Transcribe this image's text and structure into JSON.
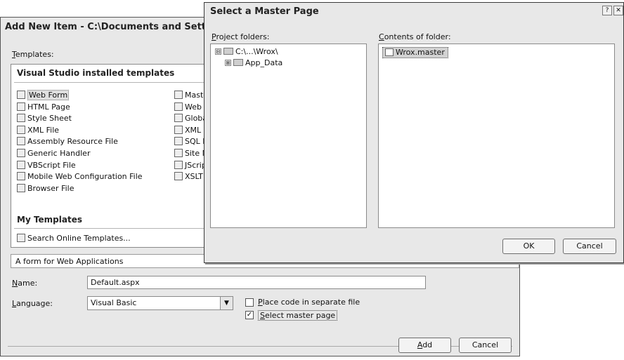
{
  "add_item_dialog": {
    "title": "Add New Item - C:\\Documents and Settin",
    "templates_label": "Templates:",
    "installed_header": "Visual Studio installed templates",
    "templates_left": [
      {
        "label": "Web Form",
        "icon": "web-form-icon",
        "selected": true
      },
      {
        "label": "HTML Page",
        "icon": "html-page-icon"
      },
      {
        "label": "Style Sheet",
        "icon": "style-sheet-icon"
      },
      {
        "label": "XML File",
        "icon": "xml-file-icon"
      },
      {
        "label": "Assembly Resource File",
        "icon": "resource-file-icon"
      },
      {
        "label": "Generic Handler",
        "icon": "generic-handler-icon"
      },
      {
        "label": "VBScript File",
        "icon": "vbscript-file-icon"
      },
      {
        "label": "Mobile Web Configuration File",
        "icon": "mobile-config-icon"
      },
      {
        "label": "Browser File",
        "icon": "browser-file-icon"
      }
    ],
    "templates_right": [
      {
        "label": "Maste",
        "icon": "master-page-icon"
      },
      {
        "label": "Web",
        "icon": "web-service-icon"
      },
      {
        "label": "Globa",
        "icon": "global-app-icon"
      },
      {
        "label": "XML S",
        "icon": "xml-schema-icon"
      },
      {
        "label": "SQL D",
        "icon": "sql-database-icon"
      },
      {
        "label": "Site M",
        "icon": "site-map-icon"
      },
      {
        "label": "JScrip",
        "icon": "jscript-file-icon"
      },
      {
        "label": "XSLT",
        "icon": "xslt-file-icon"
      }
    ],
    "my_templates_header": "My Templates",
    "search_online": "Search Online Templates...",
    "description": "A form for Web Applications",
    "name_label": "Name:",
    "name_value": "Default.aspx",
    "language_label": "Language:",
    "language_value": "Visual Basic",
    "place_code_label": "Place code in separate file",
    "place_code_checked": false,
    "select_master_label": "Select master page",
    "select_master_checked": true,
    "add_button": "Add",
    "cancel_button": "Cancel"
  },
  "master_page_dialog": {
    "title": "Select a Master Page",
    "project_folders_label": "Project folders:",
    "contents_label": "Contents of folder:",
    "tree": [
      {
        "label": "C:\\...\\Wrox\\",
        "expander": "⊟",
        "icon": "web-project-icon"
      },
      {
        "label": "App_Data",
        "expander": "⊞",
        "icon": "folder-icon"
      }
    ],
    "files": [
      {
        "label": "Wrox.master",
        "icon": "master-file-icon",
        "selected": true
      }
    ],
    "ok_button": "OK",
    "cancel_button": "Cancel",
    "help_glyph": "?",
    "close_glyph": "✕"
  }
}
